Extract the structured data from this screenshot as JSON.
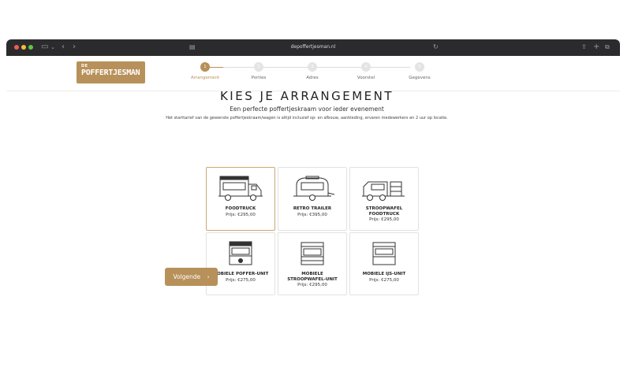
{
  "browser": {
    "url": "depoffertjesman.nl"
  },
  "logo": {
    "small": "DE",
    "big": "POFFERTJESMAN"
  },
  "steps": [
    {
      "number": "1",
      "label": "Arrangement",
      "active": true
    },
    {
      "number": "2",
      "label": "Porties",
      "active": false
    },
    {
      "number": "3",
      "label": "Adres",
      "active": false
    },
    {
      "number": "4",
      "label": "Voorstel",
      "active": false
    },
    {
      "number": "5",
      "label": "Gegevens",
      "active": false
    }
  ],
  "heading": "KIES JE ARRANGEMENT",
  "subheading": "Een perfecte poffertjeskraam voor ieder evenement",
  "description": "Het starttarief van de gewenste poffertjeskraam/wagen is altijd inclusief op- en afbouw, aankleding, ervaren medewerkers en 2 uur op locatie.",
  "cards": [
    {
      "title": "FOODTRUCK",
      "price": "Prijs: €295,00",
      "icon": "foodtruck-icon",
      "selected": true
    },
    {
      "title": "RETRO TRAILER",
      "price": "Prijs: €395,00",
      "icon": "retro-trailer-icon",
      "selected": false
    },
    {
      "title": "STROOPWAFEL FOODTRUCK",
      "price": "Prijs: €295,00",
      "icon": "stroopwafel-foodtruck-icon",
      "selected": false
    },
    {
      "title": "MOBIELE POFFER-UNIT",
      "price": "Prijs: €275,00",
      "icon": "poffer-unit-icon",
      "selected": false
    },
    {
      "title": "MOBIELE STROOPWAFEL-UNIT",
      "price": "Prijs: €295,00",
      "icon": "stroopwafel-unit-icon",
      "selected": false
    },
    {
      "title": "MOBIELE IJS-UNIT",
      "price": "Prijs: €275,00",
      "icon": "ijs-unit-icon",
      "selected": false
    }
  ],
  "next_button": "Volgende",
  "colors": {
    "accent": "#b7905a",
    "titlebar": "#2b2b2d"
  }
}
